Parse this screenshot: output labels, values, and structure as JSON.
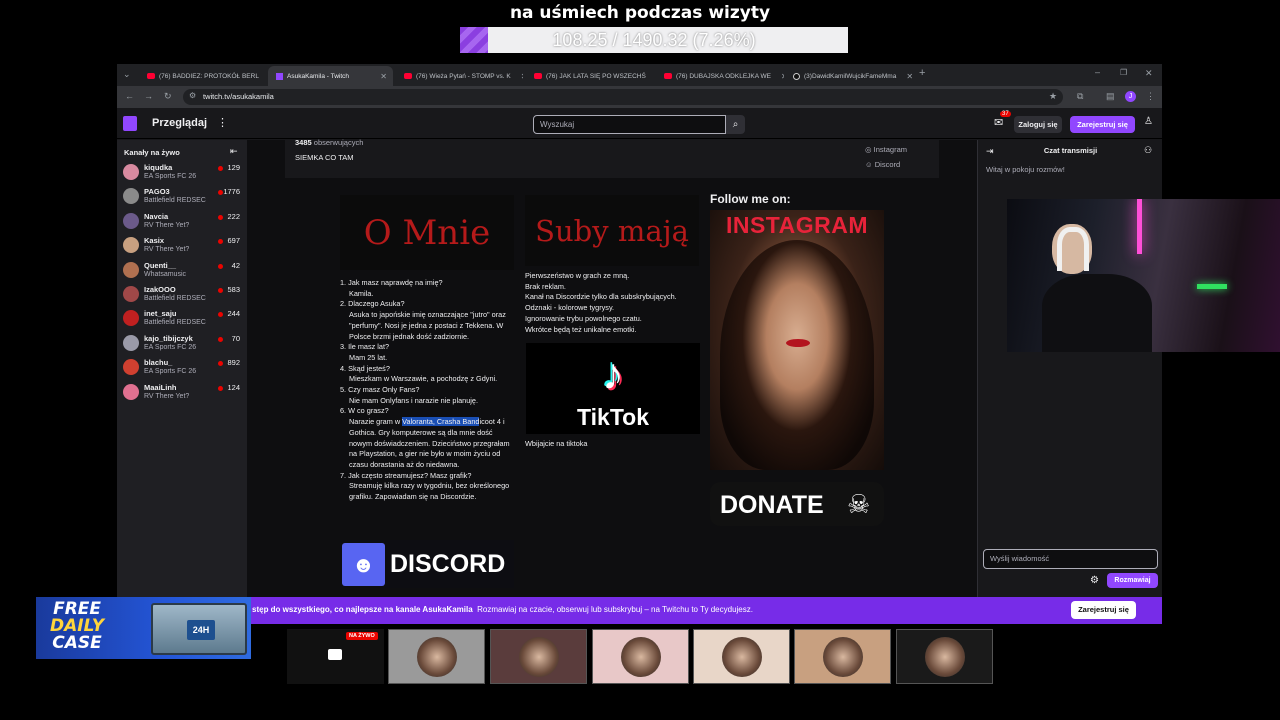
{
  "overlay": {
    "title": "na uśmiech podczas wizyty",
    "progress_text": "108.25 / 1490.32 (7.26%)",
    "progress_fraction": 0.0726
  },
  "browser": {
    "tabs": [
      {
        "label": "(76) BADDIEZ: PROTOKÓŁ BERL",
        "icon": "youtube-icon",
        "active": false
      },
      {
        "label": "AsukaKamila - Twitch",
        "icon": "twitch-icon",
        "active": true
      },
      {
        "label": "(76) Wieża Pytań - STOMP vs. K",
        "icon": "youtube-icon",
        "active": false
      },
      {
        "label": "(76) JAK LATA SIĘ PO WSZECHŚ",
        "icon": "youtube-icon",
        "active": false
      },
      {
        "label": "(76) DUBAJSKA ODKLEJKA WE",
        "icon": "youtube-icon",
        "active": false
      },
      {
        "label": "(3)DawidKamilWujcikFameMma",
        "icon": "tiktok-icon",
        "active": false
      }
    ],
    "url": "twitch.tv/asukakamila"
  },
  "twitch_nav": {
    "browse": "Przeglądaj",
    "more": "⋮",
    "search_placeholder": "Wyszukaj",
    "notification_count": "37",
    "login": "Zaloguj się",
    "signup": "Zarejestruj się"
  },
  "sidebar": {
    "title": "Kanały na żywo",
    "channels": [
      {
        "name": "kiqudka",
        "game": "EA Sports FC 26",
        "viewers": "129",
        "color": "#d88aa0"
      },
      {
        "name": "PAGO3",
        "game": "Battlefield REDSEC",
        "viewers": "1776",
        "color": "#8a8a8a"
      },
      {
        "name": "Navcia",
        "game": "RV There Yet?",
        "viewers": "222",
        "color": "#6b5a8a"
      },
      {
        "name": "Kasix",
        "game": "RV There Yet?",
        "viewers": "697",
        "color": "#c8a080"
      },
      {
        "name": "Quenti__",
        "game": "Whatsamusic",
        "viewers": "42",
        "color": "#b07050"
      },
      {
        "name": "IzakOOO",
        "game": "Battlefield REDSEC",
        "viewers": "583",
        "color": "#a04848"
      },
      {
        "name": "inet_saju",
        "game": "Battlefield REDSEC",
        "viewers": "244",
        "color": "#c02020"
      },
      {
        "name": "kajo_tibijczyk",
        "game": "EA Sports FC 26",
        "viewers": "70",
        "color": "#9a9aa8"
      },
      {
        "name": "blachu_",
        "game": "EA Sports FC 26",
        "viewers": "892",
        "color": "#d04030"
      },
      {
        "name": "MaaiLinh",
        "game": "RV There Yet?",
        "viewers": "124",
        "color": "#e07090"
      }
    ]
  },
  "channel_info": {
    "followers_count": "3485",
    "followers_label": "obserwujących",
    "bio": "SIEMKA CO TAM",
    "links": [
      "Instagram",
      "Discord"
    ]
  },
  "panels": {
    "o_mnie_title": "O Mnie",
    "suby_title": "Suby mają",
    "faq": [
      {
        "q": "1. Jak masz naprawdę na imię?",
        "a": "Kamila."
      },
      {
        "q": "2. Dlaczego Asuka?",
        "a": "Asuka to japońskie imię oznaczające \"jutro\" oraz \"perfumy\". Nosi je jedna z postaci z Tekkena. W Polsce brzmi jednak dość zadziornie."
      },
      {
        "q": "3. Ile masz lat?",
        "a": "Mam 25 lat."
      },
      {
        "q": "4. Skąd jesteś?",
        "a": "Mieszkam w Warszawie, a pochodzę z Gdyni."
      },
      {
        "q": "5. Czy masz Only Fans?",
        "a": "Nie mam Onlyfans i narazie nie planuję."
      },
      {
        "q": "6. W co grasz?",
        "a_pre": "Narazie gram w ",
        "a_hl": "Valoranta, Crasha Band",
        "a_post": "icoot 4 i Gothica. Gry komputerowe są dla mnie dość nowym doświadczeniem. Dzieciństwo przegrałam na Playstation, a gier nie było w moim życiu od czasu dorastania aż do niedawna."
      },
      {
        "q": "7. Jak często streamujesz? Masz grafik?",
        "a": "Streamuję kilka razy w tygodniu, bez określonego grafiku. Zapowiadam się na Discordzie."
      }
    ],
    "perks": [
      "Pierwszeństwo w grach ze mną.",
      "Brak reklam.",
      "Kanał na Discordzie tylko dla subskrybujących.",
      "Odznaki - kolorowe tygrysy.",
      "Ignorowanie trybu powolnego czatu.",
      "Wkrótce będą też unikalne emotki."
    ],
    "tiktok_word": "TikTok",
    "tiktok_caption": "Wbijajcie na tiktoka",
    "discord_word": "DISCORD",
    "follow_title": "Follow me on:",
    "instagram_word": "INSTAGRAM",
    "donate_word": "DONATE"
  },
  "chat": {
    "title": "Czat transmisji",
    "welcome": "Witaj w pokoju rozmów!",
    "input_placeholder": "Wyślij wiadomość",
    "send": "Rozmawiaj"
  },
  "banner": {
    "text_bold": "stęp do wszystkiego, co najlepsze na kanale AsukaKamila",
    "text_rest": "Rozmawiaj na czacie, obserwuj lub subskrybuj – na Twitchu to Ty decydujesz.",
    "button": "Zarejestruj się"
  },
  "case_ad": {
    "line1": "FREE",
    "line2": "DAILY",
    "line3": "CASE",
    "box_label": "24H"
  },
  "strip": {
    "live_label": "NA ŻYWO",
    "thumbs": [
      "#9a9a9a",
      "#5a3c3c",
      "#e8c8c8",
      "#e8d6c8",
      "#c8a080",
      "#1a1a1a"
    ]
  },
  "colors": {
    "twitch_purple": "#9147ff",
    "banner_purple": "#772ce8",
    "live_red": "#eb0400"
  }
}
